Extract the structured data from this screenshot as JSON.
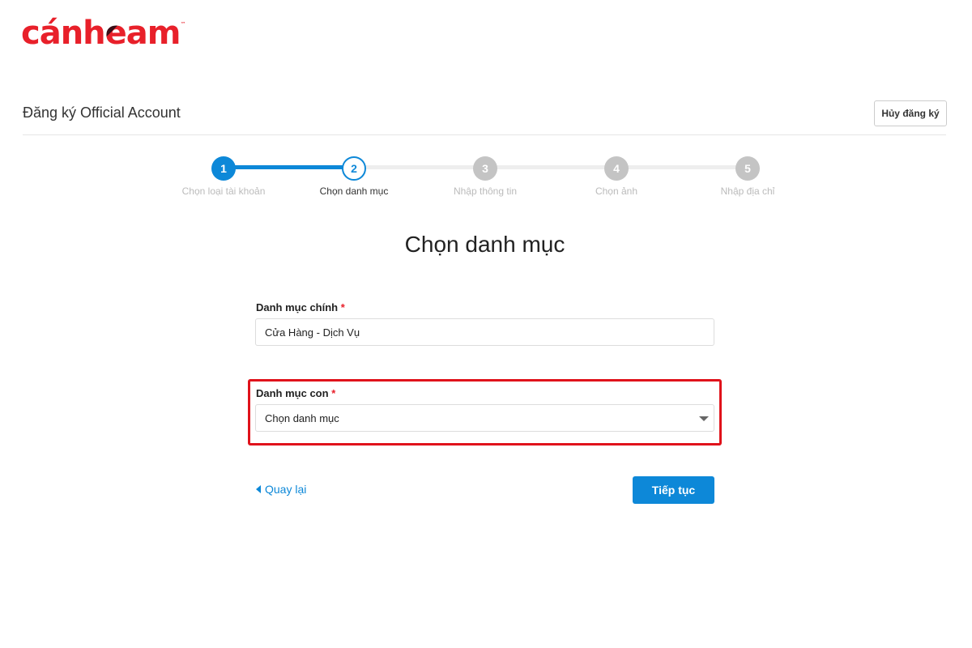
{
  "brand": {
    "logo_text_before": "cánh",
    "logo_e": "e",
    "logo_text_after": "am",
    "tm": "™",
    "color": "#e8202a"
  },
  "header": {
    "title": "Đăng ký Official Account",
    "cancel_label": "Hủy đăng ký"
  },
  "stepper": {
    "current_step": 2,
    "accent": "#0d88d8",
    "steps": [
      {
        "number": "1",
        "label": "Chọn loại tài khoản",
        "state": "done"
      },
      {
        "number": "2",
        "label": "Chọn danh mục",
        "state": "current"
      },
      {
        "number": "3",
        "label": "Nhập thông tin",
        "state": "pending"
      },
      {
        "number": "4",
        "label": "Chọn ảnh",
        "state": "pending"
      },
      {
        "number": "5",
        "label": "Nhập địa chỉ",
        "state": "pending"
      }
    ]
  },
  "main": {
    "heading": "Chọn danh mục",
    "main_category": {
      "label": "Danh mục chính",
      "required": "*",
      "value": "Cửa Hàng - Dịch Vụ"
    },
    "sub_category": {
      "label": "Danh mục con",
      "required": "*",
      "value": "Chọn danh mục",
      "icon": "caret-down-icon"
    },
    "highlight_color": "#e0121b",
    "back_label": "Quay lại",
    "next_label": "Tiếp tục"
  }
}
